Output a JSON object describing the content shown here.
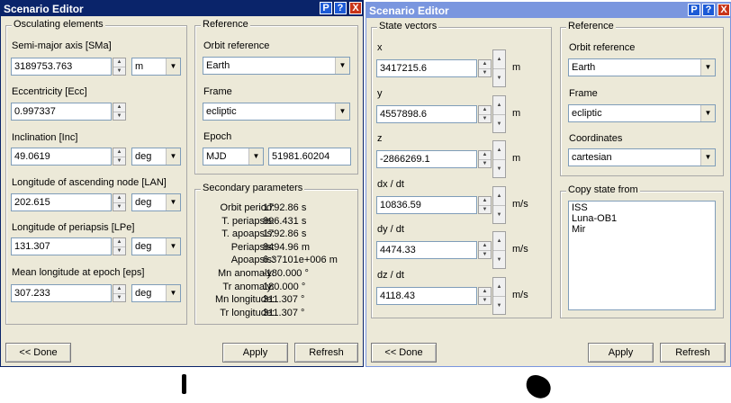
{
  "left": {
    "title": "Scenario Editor",
    "osc": {
      "group": "Osculating elements",
      "sma_label": "Semi-major axis [SMa]",
      "sma": "3189753.763",
      "sma_unit": "m",
      "ecc_label": "Eccentricity [Ecc]",
      "ecc": "0.997337",
      "inc_label": "Inclination [Inc]",
      "inc": "49.0619",
      "inc_unit": "deg",
      "lan_label": "Longitude of ascending node [LAN]",
      "lan": "202.615",
      "lan_unit": "deg",
      "lpe_label": "Longitude of periapsis [LPe]",
      "lpe": "131.307",
      "lpe_unit": "deg",
      "eps_label": "Mean longitude at epoch [eps]",
      "eps": "307.233",
      "eps_unit": "deg"
    },
    "ref": {
      "group": "Reference",
      "orbit_label": "Orbit reference",
      "orbit": "Earth",
      "frame_label": "Frame",
      "frame": "ecliptic",
      "epoch_label": "Epoch",
      "epoch_fmt": "MJD",
      "epoch": "51981.60204"
    },
    "sec": {
      "group": "Secondary parameters",
      "rows": [
        {
          "k": "Orbit period:",
          "v": "1792.86 s"
        },
        {
          "k": "T. periapsis:",
          "v": "896.431 s"
        },
        {
          "k": "T. apoapsis:",
          "v": "1792.86 s"
        },
        {
          "k": "Periapsis:",
          "v": "8494.96 m"
        },
        {
          "k": "Apoapsis:",
          "v": "6.37101e+006 m"
        },
        {
          "k": "Mn anomaly:",
          "v": "-180.000 °"
        },
        {
          "k": "Tr anomaly:",
          "v": "180.000 °"
        },
        {
          "k": "Mn longitude:",
          "v": "311.307 °"
        },
        {
          "k": "Tr longitude:",
          "v": "311.307 °"
        }
      ]
    },
    "done": "<< Done",
    "apply": "Apply",
    "refresh": "Refresh"
  },
  "right": {
    "title": "Scenario Editor",
    "sv": {
      "group": "State vectors",
      "x_label": "x",
      "x": "3417215.6",
      "x_unit": "m",
      "y_label": "y",
      "y": "4557898.6",
      "y_unit": "m",
      "z_label": "z",
      "z": "-2866269.1",
      "z_unit": "m",
      "dx_label": "dx / dt",
      "dx": "10836.59",
      "dx_unit": "m/s",
      "dy_label": "dy / dt",
      "dy": "4474.33",
      "dy_unit": "m/s",
      "dz_label": "dz / dt",
      "dz": "4118.43",
      "dz_unit": "m/s"
    },
    "ref": {
      "group": "Reference",
      "orbit_label": "Orbit reference",
      "orbit": "Earth",
      "frame_label": "Frame",
      "frame": "ecliptic",
      "coord_label": "Coordinates",
      "coord": "cartesian"
    },
    "copy": {
      "group": "Copy state from",
      "items": [
        "ISS",
        "Luna-OB1",
        "Mir"
      ]
    },
    "done": "<< Done",
    "apply": "Apply",
    "refresh": "Refresh"
  },
  "title_buttons": {
    "pin": "P",
    "help": "?",
    "close": "X"
  }
}
